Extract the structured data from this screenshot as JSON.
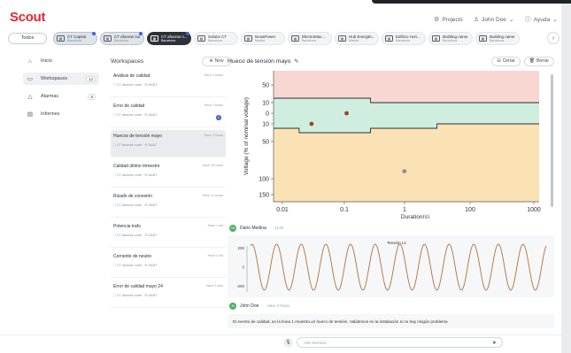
{
  "app": {
    "logo": "Scout"
  },
  "header": {
    "projects_label": "Projects",
    "user_label": "John Doe",
    "help_label": "Ayuda"
  },
  "sites": {
    "todos_label": "Todos",
    "items": [
      {
        "name": "CT Capital",
        "sub": "Barcelona",
        "state": "sel",
        "dot": true
      },
      {
        "name": "CT afueras sur",
        "sub": "Barcelona",
        "state": "sel",
        "dot": true
      },
      {
        "name": "CT afueras n...",
        "sub": "Barcelona",
        "state": "active",
        "dot": true
      },
      {
        "name": "Solarix CT",
        "sub": "Barcelona",
        "state": "",
        "dot": false
      },
      {
        "name": "NovaPower",
        "sub": "Madrid",
        "state": "",
        "dot": false
      },
      {
        "name": "ElectroMax...",
        "sub": "Barcelona",
        "state": "",
        "dot": false
      },
      {
        "name": "Hub EnergEt...",
        "sub": "Madrid",
        "state": "",
        "dot": false
      },
      {
        "name": "Edificio Hori...",
        "sub": "Barcelona",
        "state": "",
        "dot": false
      },
      {
        "name": "Building name",
        "sub": "Barcelona",
        "state": "",
        "dot": false
      },
      {
        "name": "Building name",
        "sub": "Barcelona",
        "state": "",
        "dot": false
      }
    ]
  },
  "nav": {
    "items": [
      {
        "label": "Inicio",
        "icon": "home-icon",
        "glyph": "⌂",
        "badge": "",
        "active": false
      },
      {
        "label": "Workspaces",
        "icon": "chat-icon",
        "glyph": "▭",
        "badge": "12",
        "active": true
      },
      {
        "label": "Alarmas",
        "icon": "bell-icon",
        "glyph": "△",
        "badge": "8",
        "active": false
      },
      {
        "label": "Informes",
        "icon": "report-icon",
        "glyph": "▤",
        "badge": "",
        "active": false
      }
    ]
  },
  "workspaces": {
    "title": "Workspaces",
    "new_label": "New",
    "items": [
      {
        "name": "Análisis de calidad",
        "sub": "CT afueras norte · R-SABT",
        "time": "Hace 2 horas",
        "badge": "",
        "active": false
      },
      {
        "name": "Error de calidad",
        "sub": "CT afueras norte · R-SABT",
        "time": "Hace 3 horas",
        "badge": "6",
        "active": false
      },
      {
        "name": "Huecos de tensión mayo",
        "sub": "CT afueras norte · R-SABT",
        "time": "Hace 3 horas",
        "badge": "",
        "active": true
      },
      {
        "name": "Calidad último trimestre",
        "sub": "CT afueras norte · R-SABT",
        "time": "Hace 10 horas",
        "badge": "",
        "active": false
      },
      {
        "name": "Rizado de conexión",
        "sub": "CT afueras norte · R-SABT",
        "time": "Hace 12 horas",
        "badge": "",
        "active": false
      },
      {
        "name": "Potencia trafo",
        "sub": "CT afueras norte · R-SABT",
        "time": "Hace 1 día",
        "badge": "",
        "active": false
      },
      {
        "name": "Corriente de neutro",
        "sub": "CT afueras norte · R-SABT",
        "time": "Hace 1 día",
        "badge": "",
        "active": false
      },
      {
        "name": "Error de calidad mayo 24",
        "sub": "CT afueras norte · R-SABT",
        "time": "Hace 3 días",
        "badge": "",
        "active": false
      }
    ]
  },
  "main": {
    "title": "Hueco de tensión mayo",
    "close_label": "Cerrar",
    "delete_label": "Borrar"
  },
  "conversation": {
    "first_user": "Dario Medina",
    "first_time": "11:02",
    "wave_title": "Tensión L1",
    "second_user": "John Doe",
    "second_time": "Hace 3 horas",
    "message": "El evento de calidad, en la línea 1 muestra un hueco de tensión. Validemos en la instalación si no hay ningún problema"
  },
  "composer": {
    "placeholder": "Ask Hermes..."
  },
  "chart_data": [
    {
      "type": "scatter",
      "xlabel": "Duration(s)",
      "ylabel": "Voltage (% of nominal voltage)",
      "x_scale": "log",
      "x_ticks": [
        "0.01",
        "0.1",
        "1",
        "100",
        "1000"
      ],
      "y_ticks": [
        "50",
        "10",
        "0",
        "10",
        "50",
        "100",
        "150"
      ],
      "points": [
        {
          "x": 0.035,
          "y": -10,
          "color": "#a0471e"
        },
        {
          "x": 0.17,
          "y": 0,
          "color": "#a0471e"
        },
        {
          "x": 2.3,
          "y": -90,
          "color": "#8a8f97"
        }
      ]
    },
    {
      "type": "line",
      "title": "Tensión L1",
      "y_ticks": [
        "200",
        "0",
        "-200"
      ],
      "cycles": 12,
      "amplitude": 240
    }
  ],
  "colors": {
    "brand": "#e3262d",
    "band_red": "#f8d7d3",
    "band_green": "#cfeee0",
    "band_yellow": "#fbe2b4",
    "line": "#2b2f36"
  }
}
